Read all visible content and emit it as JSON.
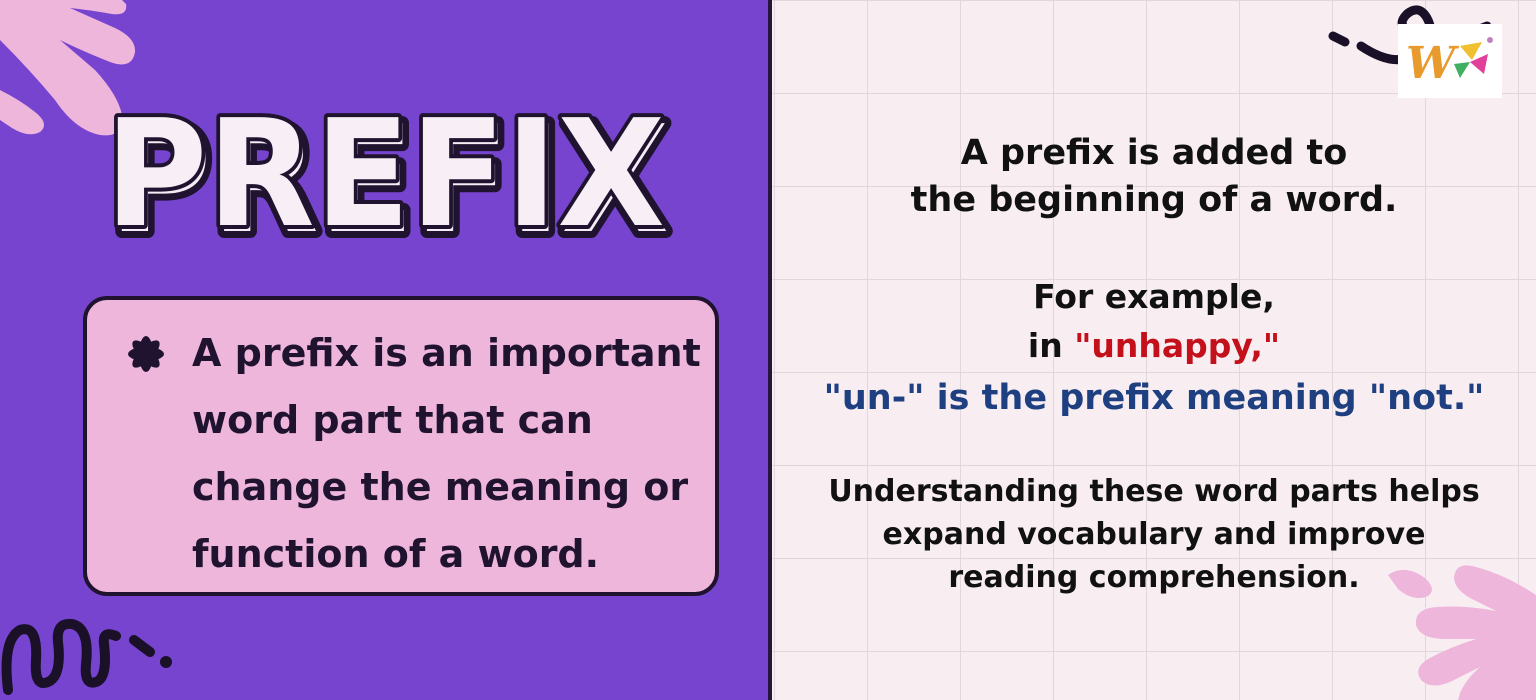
{
  "title": "PREFIX",
  "callout": {
    "lines": [
      "A prefix is an important",
      "word part that can",
      "change the meaning or",
      "function of a word."
    ]
  },
  "right": {
    "intro_line1": "A prefix is added to",
    "intro_line2": "the beginning of a word.",
    "example_line1": "For example,",
    "example_line2_prefix": "in ",
    "example_line2_word": "\"unhappy,\"",
    "example_line3": "\"un-\" is the prefix meaning \"not.\"",
    "summary_line1": "Understanding these word parts helps",
    "summary_line2": "expand vocabulary and improve",
    "summary_line3": "reading comprehension."
  },
  "colors": {
    "left_background": "#7744d0",
    "callout_background": "#efb6dc",
    "right_background": "#f8eef2",
    "highlight_red": "#c3101a",
    "highlight_blue": "#1e3f80",
    "outline_dark": "#1f1330"
  },
  "icons": {
    "bullet": "asterisk-flower-icon",
    "logo": "w-logo-icon"
  }
}
